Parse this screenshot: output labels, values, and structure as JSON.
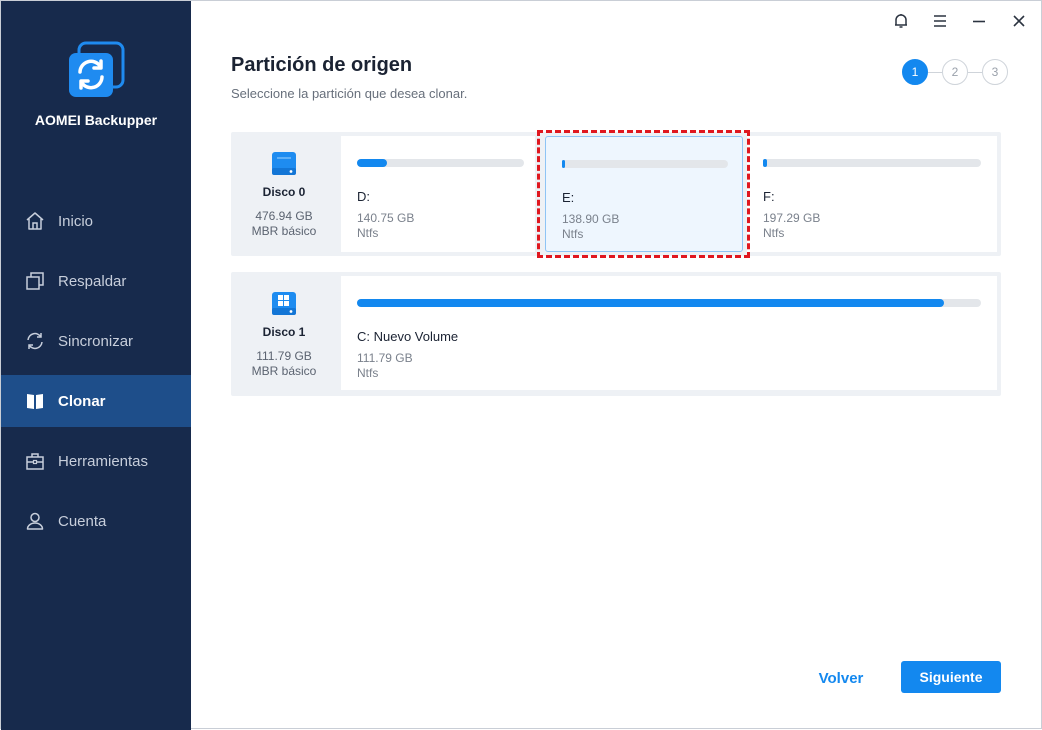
{
  "app": {
    "name": "AOMEI Backupper"
  },
  "sidebar": {
    "items": [
      {
        "label": "Inicio",
        "icon": "home-icon",
        "active": false
      },
      {
        "label": "Respaldar",
        "icon": "backup-icon",
        "active": false
      },
      {
        "label": "Sincronizar",
        "icon": "sync-icon",
        "active": false
      },
      {
        "label": "Clonar",
        "icon": "clone-icon",
        "active": true
      },
      {
        "label": "Herramientas",
        "icon": "toolbox-icon",
        "active": false
      },
      {
        "label": "Cuenta",
        "icon": "user-icon",
        "active": false
      }
    ]
  },
  "topbar": {
    "icons": [
      "bell-icon",
      "menu-icon",
      "minimize-icon",
      "close-icon"
    ]
  },
  "header": {
    "title": "Partición de origen",
    "subtitle": "Seleccione la partición que desea clonar."
  },
  "steps": [
    "1",
    "2",
    "3"
  ],
  "disks": [
    {
      "name": "Disco 0",
      "size": "476.94 GB",
      "type": "MBR básico",
      "partitions": [
        {
          "label": "D:",
          "size": "140.75 GB",
          "fs": "Ntfs",
          "used": 0.18,
          "selected": false
        },
        {
          "label": "E:",
          "size": "138.90 GB",
          "fs": "Ntfs",
          "used": 0.02,
          "selected": true
        },
        {
          "label": "F:",
          "size": "197.29 GB",
          "fs": "Ntfs",
          "used": 0.02,
          "selected": false
        }
      ]
    },
    {
      "name": "Disco 1",
      "size": "111.79 GB",
      "type": "MBR básico",
      "partitions": [
        {
          "label": "C: Nuevo Volume",
          "size": "111.79 GB",
          "fs": "Ntfs",
          "used": 0.94,
          "selected": false
        }
      ]
    }
  ],
  "footer": {
    "back_label": "Volver",
    "next_label": "Siguiente"
  },
  "colors": {
    "accent": "#1388ef",
    "sidebar": "#172a4c",
    "sidebar_active": "#1e4e8a",
    "highlight": "#e0171f"
  }
}
